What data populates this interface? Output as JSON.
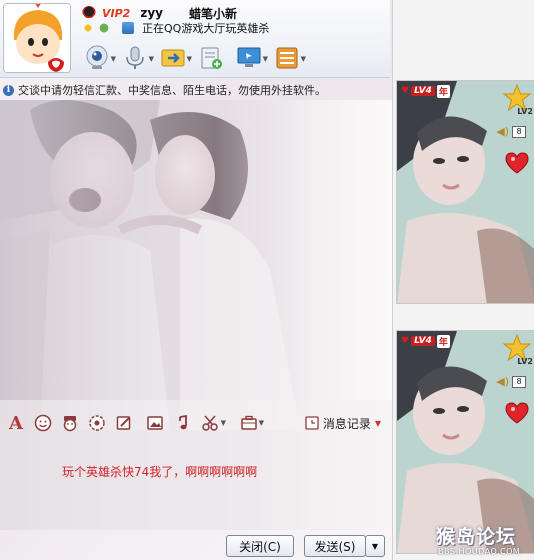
{
  "header": {
    "vip_label": "VIP2",
    "contact_name": "zyy",
    "nickname": "蜡笔小新",
    "status": "正在QQ游戏大厅玩英雄杀"
  },
  "window_controls": [
    "minimize",
    "maximize",
    "close"
  ],
  "toolbar": {
    "icons": [
      "video-call-icon",
      "voice-call-icon",
      "send-file-icon",
      "remote-assist-icon",
      "screen-share-icon",
      "app-menu-icon"
    ]
  },
  "notice": {
    "text": "交谈中请勿轻信汇款、中奖信息、陌生电话，勿使用外挂软件。"
  },
  "input_toolbar": {
    "icons": [
      "font-icon",
      "emoticon-icon",
      "magic-face-icon",
      "nudge-icon",
      "scribble-icon",
      "image-icon",
      "music-icon",
      "screenshot-icon",
      "more-tools-icon"
    ],
    "history_label": "消息记录"
  },
  "input": {
    "message": "玩个英雄杀快74我了，啊啊啊啊啊啊"
  },
  "buttons": {
    "close": "关闭(C)",
    "send": "发送(S)"
  },
  "show_panel": {
    "cards": [
      {
        "level": "LV4",
        "year_tag": "年",
        "star_level": "LV2",
        "sound_tag": "8"
      },
      {
        "level": "LV4",
        "year_tag": "年",
        "star_level": "LV2",
        "sound_tag": "8"
      }
    ]
  },
  "watermark": {
    "title": "猴岛论坛",
    "url": "BBS.HOUDAO.COM"
  },
  "colors": {
    "message_text": "#d0232a",
    "vip_badge": "#e03c1a",
    "level_badge": "#c62020",
    "header_bg": "#eef1f7"
  }
}
